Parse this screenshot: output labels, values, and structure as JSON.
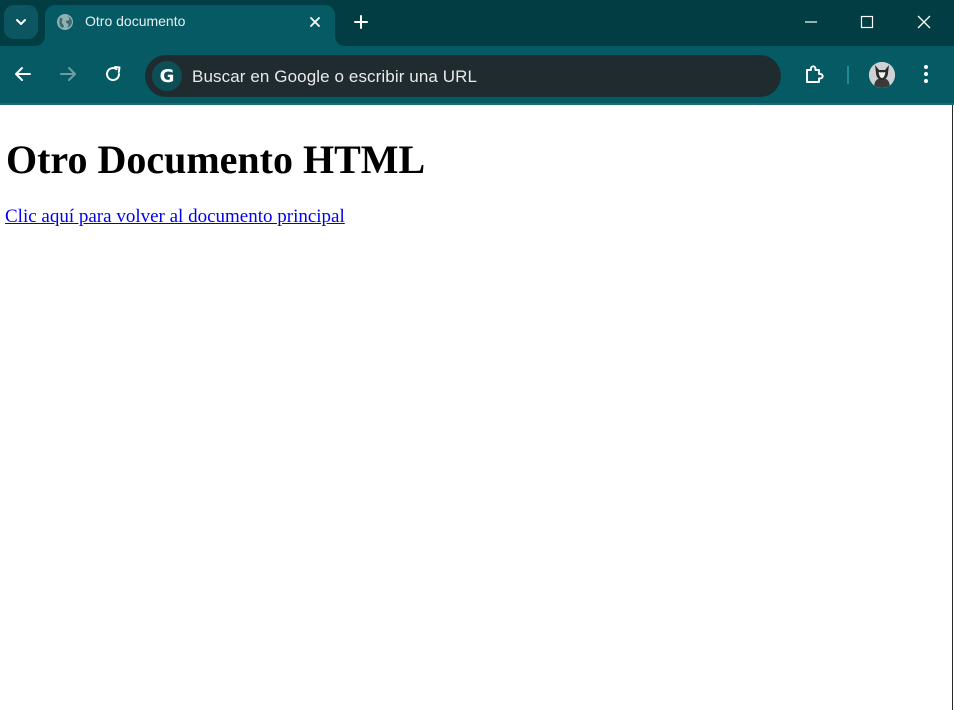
{
  "browser": {
    "tab": {
      "title": "Otro documento"
    },
    "omnibox": {
      "placeholder": "Buscar en Google o escribir una URL"
    },
    "icons": {
      "tab_search": "chevron-down-icon",
      "favicon": "globe-icon",
      "tab_close": "close-icon",
      "new_tab": "plus-icon",
      "minimize": "minimize-icon",
      "maximize": "maximize-icon",
      "close_window": "close-icon",
      "back": "arrow-left-icon",
      "forward": "arrow-right-icon",
      "reload": "reload-icon",
      "omnibox_badge": "google-g-icon",
      "extensions": "puzzle-icon",
      "profile": "avatar-icon",
      "menu": "kebab-menu-icon"
    },
    "colors": {
      "tab_strip": "#033d44",
      "toolbar": "#055a63",
      "omnibox": "#1f2b2e"
    }
  },
  "page": {
    "heading": "Otro Documento HTML",
    "link_text": "Clic aquí para volver al documento principal",
    "link_color": "#0000ee"
  }
}
